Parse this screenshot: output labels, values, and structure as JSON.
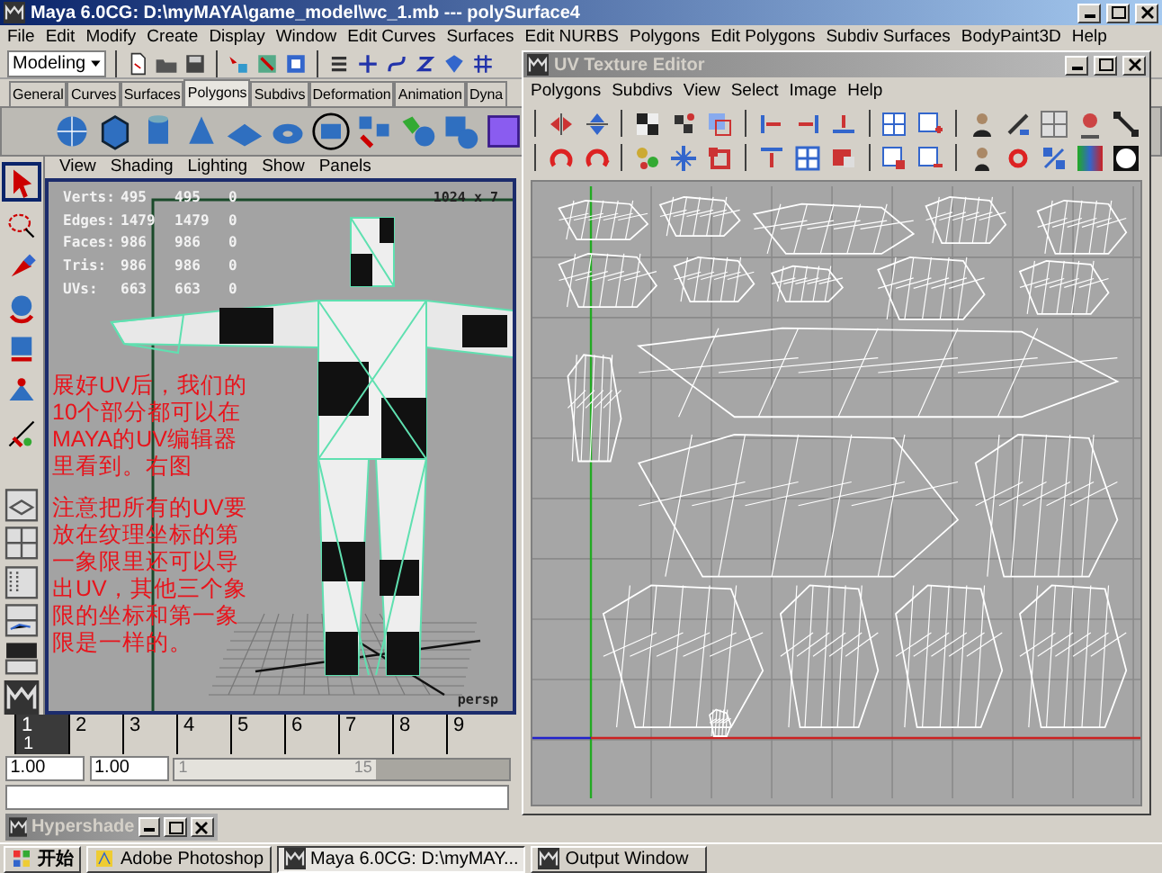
{
  "window": {
    "title": "Maya 6.0CG: D:\\myMAYA\\game_model\\wc_1.mb  ---  polySurface4"
  },
  "menu_bar": [
    "File",
    "Edit",
    "Modify",
    "Create",
    "Display",
    "Window",
    "Edit Curves",
    "Surfaces",
    "Edit NURBS",
    "Polygons",
    "Edit Polygons",
    "Subdiv Surfaces",
    "BodyPaint3D",
    "Help"
  ],
  "status_line": {
    "mode": "Modeling"
  },
  "shelf_tabs": [
    {
      "label": "General",
      "selected": false
    },
    {
      "label": "Curves",
      "selected": false
    },
    {
      "label": "Surfaces",
      "selected": false
    },
    {
      "label": "Polygons",
      "selected": true
    },
    {
      "label": "Subdivs",
      "selected": false
    },
    {
      "label": "Deformation",
      "selected": false
    },
    {
      "label": "Animation",
      "selected": false
    },
    {
      "label": "Dyna",
      "selected": false
    }
  ],
  "viewport": {
    "menu": [
      "View",
      "Shading",
      "Lighting",
      "Show",
      "Panels"
    ],
    "stats": [
      {
        "label": "Verts:",
        "values": [
          "495",
          "495",
          "0"
        ]
      },
      {
        "label": "Edges:",
        "values": [
          "1479",
          "1479",
          "0"
        ]
      },
      {
        "label": "Faces:",
        "values": [
          "986",
          "986",
          "0"
        ]
      },
      {
        "label": "Tris:",
        "values": [
          "986",
          "986",
          "0"
        ]
      },
      {
        "label": "UVs:",
        "values": [
          "663",
          "663",
          "0"
        ]
      }
    ],
    "resolution": "1024 x 7",
    "camera": "persp",
    "notes": [
      "展好UV后，我们的10个部分都可以在MAYA的UV编辑器里看到。右图",
      "注意把所有的UV要放在纹理坐标的第一象限里还可以导出UV，其他三个象限的坐标和第一象限是一样的。"
    ]
  },
  "uv_editor": {
    "title": "UV Texture Editor",
    "menu": [
      "Polygons",
      "Subdivs",
      "View",
      "Select",
      "Image",
      "Help"
    ]
  },
  "time_slider": {
    "frames": [
      {
        "label": "1",
        "selected": true
      },
      {
        "label": "2",
        "selected": false
      },
      {
        "label": "3",
        "selected": false
      },
      {
        "label": "4",
        "selected": false
      },
      {
        "label": "5",
        "selected": false
      },
      {
        "label": "6",
        "selected": false
      },
      {
        "label": "7",
        "selected": false
      },
      {
        "label": "8",
        "selected": false
      },
      {
        "label": "9",
        "selected": false
      }
    ],
    "current_frame": "1"
  },
  "range_slider": {
    "start_time": "1.00",
    "playback_start": "1.00",
    "range_start": "1",
    "range_end": "15",
    "level": 0.6
  },
  "minimized_window": {
    "title": "Hypershade"
  },
  "taskbar": {
    "start": "开始",
    "tasks": [
      {
        "label": "Adobe Photoshop",
        "selected": false
      },
      {
        "label": "Maya 6.0CG: D:\\myMAY...",
        "selected": true
      },
      {
        "label": "Output Window",
        "selected": false
      }
    ]
  }
}
